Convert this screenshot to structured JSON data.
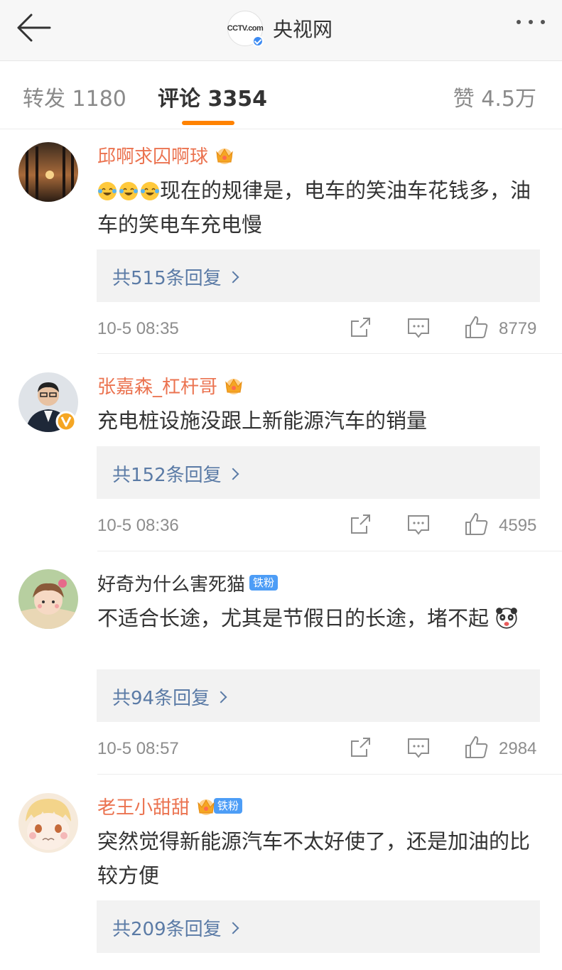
{
  "header": {
    "title": "央视网",
    "logo_text": "CCTV.com"
  },
  "tabs": {
    "repost": "转发 1180",
    "comments": "评论 3354",
    "likes": "赞 4.5万"
  },
  "colors": {
    "username": "#eb7350",
    "reply_link": "#5b7ba6",
    "tab_indicator": "#ff8200",
    "fan_badge": "#4d9df6"
  },
  "comments": [
    {
      "username": "邱啊求囚啊球",
      "crown": true,
      "fan_badge": "",
      "text": "现在的规律是，电车的笑油车花钱多，油车的笑电车充电慢",
      "emojis": [
        "laugh-cry-emoji",
        "laugh-cry-emoji",
        "laugh-cry-emoji"
      ],
      "reply_link": "共515条回复",
      "time": "10-5 08:35",
      "likes": "8779"
    },
    {
      "username": "张嘉森_杠杆哥",
      "crown": true,
      "fan_badge": "",
      "text": "充电桩设施没跟上新能源汽车的销量",
      "reply_link": "共152条回复",
      "time": "10-5 08:36",
      "likes": "4595"
    },
    {
      "username": "好奇为什么害死猫",
      "crown": false,
      "fan_badge": "铁粉",
      "text": "不适合长途，尤其是节假日的长途，堵不起",
      "emojis_after": [
        "panda-emoji"
      ],
      "reply_link": "共94条回复",
      "time": "10-5 08:57",
      "likes": "2984"
    },
    {
      "username": "老王小甜甜",
      "crown": true,
      "fan_badge": "铁粉",
      "text": "突然觉得新能源汽车不太好使了，还是加油的比较方便",
      "reply_link": "共209条回复"
    }
  ]
}
